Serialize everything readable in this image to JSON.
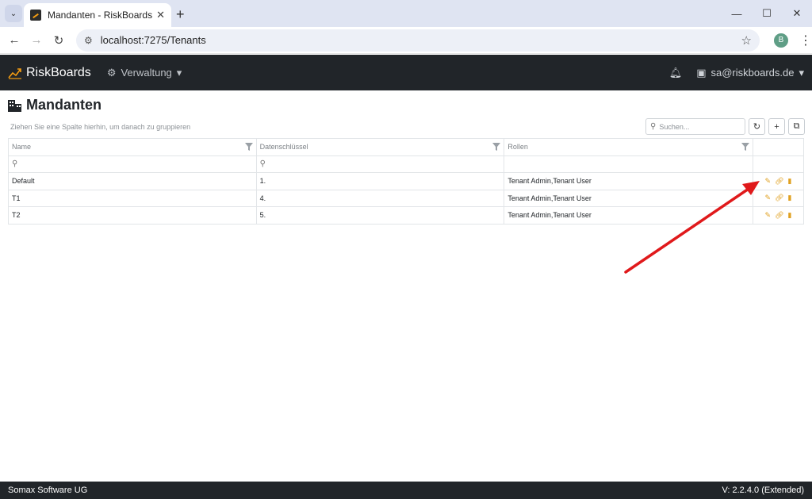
{
  "browser": {
    "tab_title": "Mandanten - RiskBoards",
    "url": "localhost:7275/Tenants",
    "profile_initial": "B",
    "icons": {
      "back": "arrow-left-icon",
      "forward": "arrow-right-icon",
      "reload": "reload-icon",
      "bookmark": "star-icon"
    }
  },
  "navbar": {
    "brand": "RiskBoards",
    "menu_label": "Verwaltung",
    "user": "sa@riskboards.de",
    "colors": {
      "background": "#212529",
      "brand_accent": "#f39c12"
    }
  },
  "page": {
    "title": "Mandanten",
    "group_hint": "Ziehen Sie eine Spalte hierhin, um danach zu gruppieren",
    "search_placeholder": "Suchen...",
    "columns": [
      "Name",
      "Datenschlüssel",
      "Rollen"
    ],
    "rows": [
      {
        "name": "Default",
        "key": "1.",
        "roles": "Tenant Admin,Tenant User"
      },
      {
        "name": "T1",
        "key": "4.",
        "roles": "Tenant Admin,Tenant User"
      },
      {
        "name": "T2",
        "key": "5.",
        "roles": "Tenant Admin,Tenant User"
      }
    ],
    "action_color": "#e0a020"
  },
  "footer": {
    "company": "Somax Software UG",
    "version": "V: 2.2.4.0 (Extended)"
  }
}
